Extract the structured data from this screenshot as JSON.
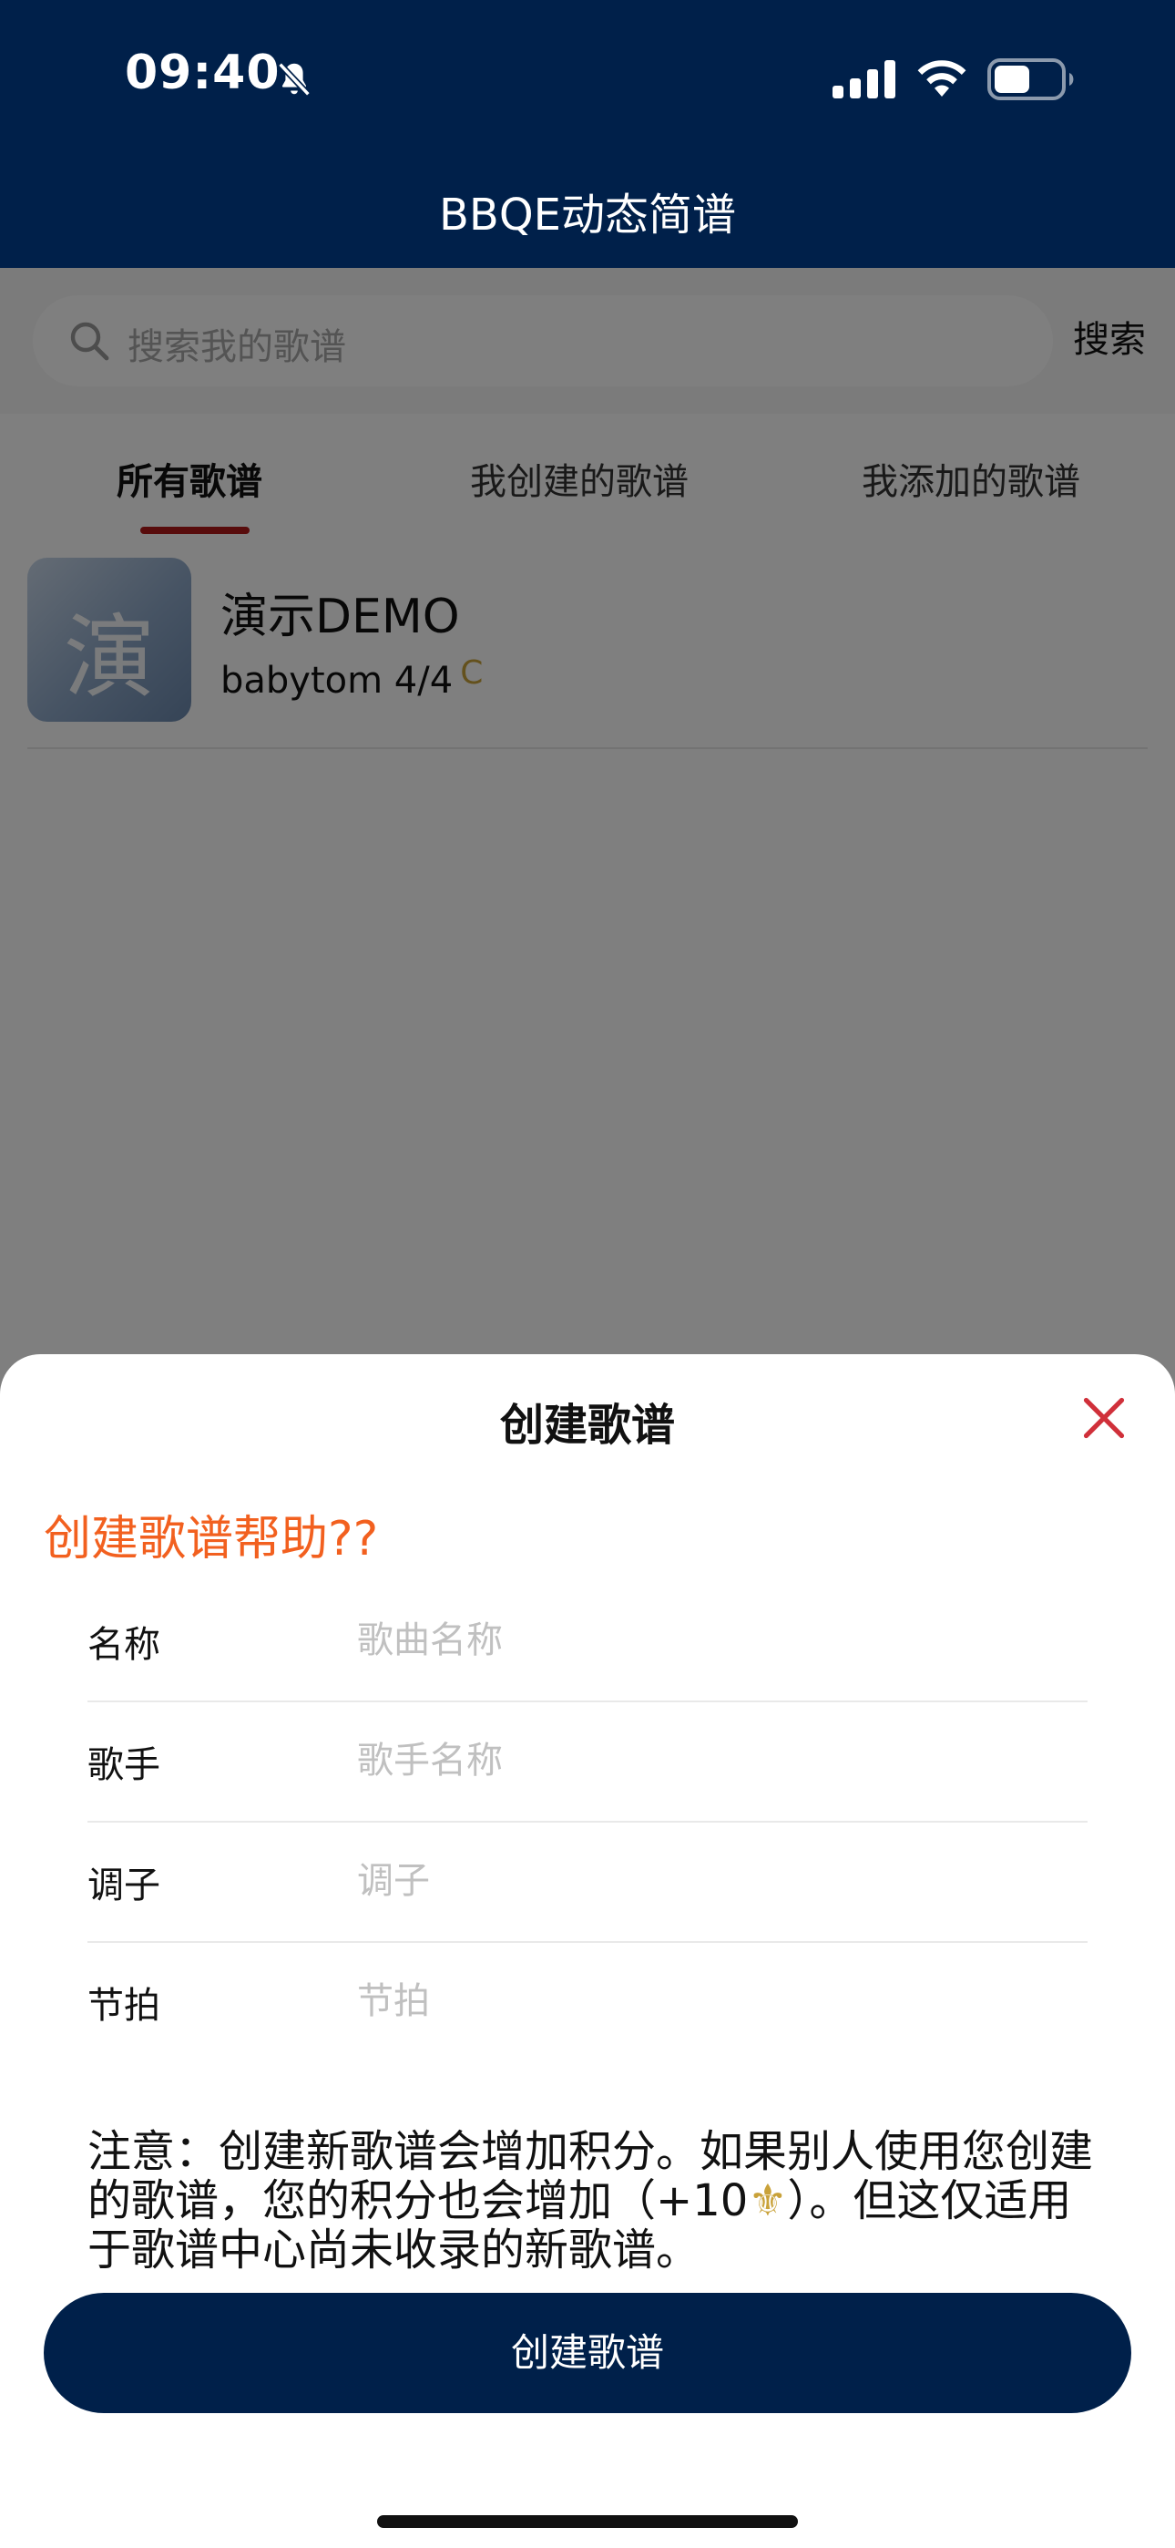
{
  "status_bar": {
    "time": "09:40",
    "icons": [
      "bell-slash-icon",
      "signal-icon",
      "wifi-icon",
      "battery-icon"
    ]
  },
  "header": {
    "title": "BBQE动态简谱"
  },
  "search": {
    "placeholder": "搜索我的歌谱",
    "button_label": "搜索"
  },
  "tabs": [
    {
      "label": "所有歌谱",
      "active": true
    },
    {
      "label": "我创建的歌谱",
      "active": false
    },
    {
      "label": "我添加的歌谱",
      "active": false
    }
  ],
  "songs": [
    {
      "thumb_char": "演",
      "title": "演示DEMO",
      "meta": "babytom 4/4",
      "key": "C"
    }
  ],
  "sheet": {
    "title": "创建歌谱",
    "help_link": "创建歌谱帮助??",
    "fields": [
      {
        "label": "名称",
        "placeholder": "歌曲名称",
        "value": ""
      },
      {
        "label": "歌手",
        "placeholder": "歌手名称",
        "value": ""
      },
      {
        "label": "调子",
        "placeholder": "调子",
        "value": ""
      },
      {
        "label": "节拍",
        "placeholder": "节拍",
        "value": ""
      }
    ],
    "notice_before": "注意：创建新歌谱会增加积分。如果别人使用您创建的歌谱，您的积分也会增加（+10",
    "notice_glyph": "⚜",
    "notice_after": "）。但这仅适用于歌谱中心尚未收录的新歌谱。",
    "submit_label": "创建歌谱"
  },
  "colors": {
    "header_bg": "#00204a",
    "accent_orange": "#f2601f",
    "tab_underline": "#b01818",
    "close_red": "#d0303a",
    "gold": "#c9a23a"
  }
}
